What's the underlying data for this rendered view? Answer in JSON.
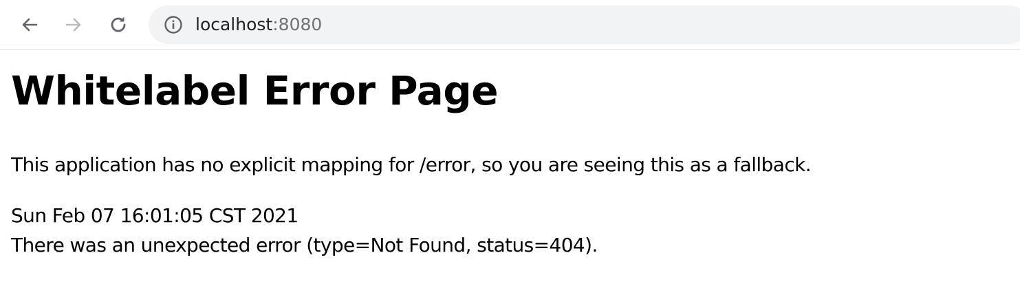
{
  "browser": {
    "back_icon": "arrow-left-icon",
    "forward_icon": "arrow-right-icon",
    "reload_icon": "reload-icon",
    "info_icon": "info-circle-icon",
    "url_host": "localhost",
    "url_port": ":8080",
    "colors": {
      "omnibox_bg": "#f1f3f4",
      "icon_active": "#5f6368",
      "icon_disabled": "#b8babd"
    }
  },
  "page": {
    "title": "Whitelabel Error Page",
    "message": "This application has no explicit mapping for /error, so you are seeing this as a fallback.",
    "timestamp": "Sun Feb 07 16:01:05 CST 2021",
    "error_detail": "There was an unexpected error (type=Not Found, status=404)."
  }
}
